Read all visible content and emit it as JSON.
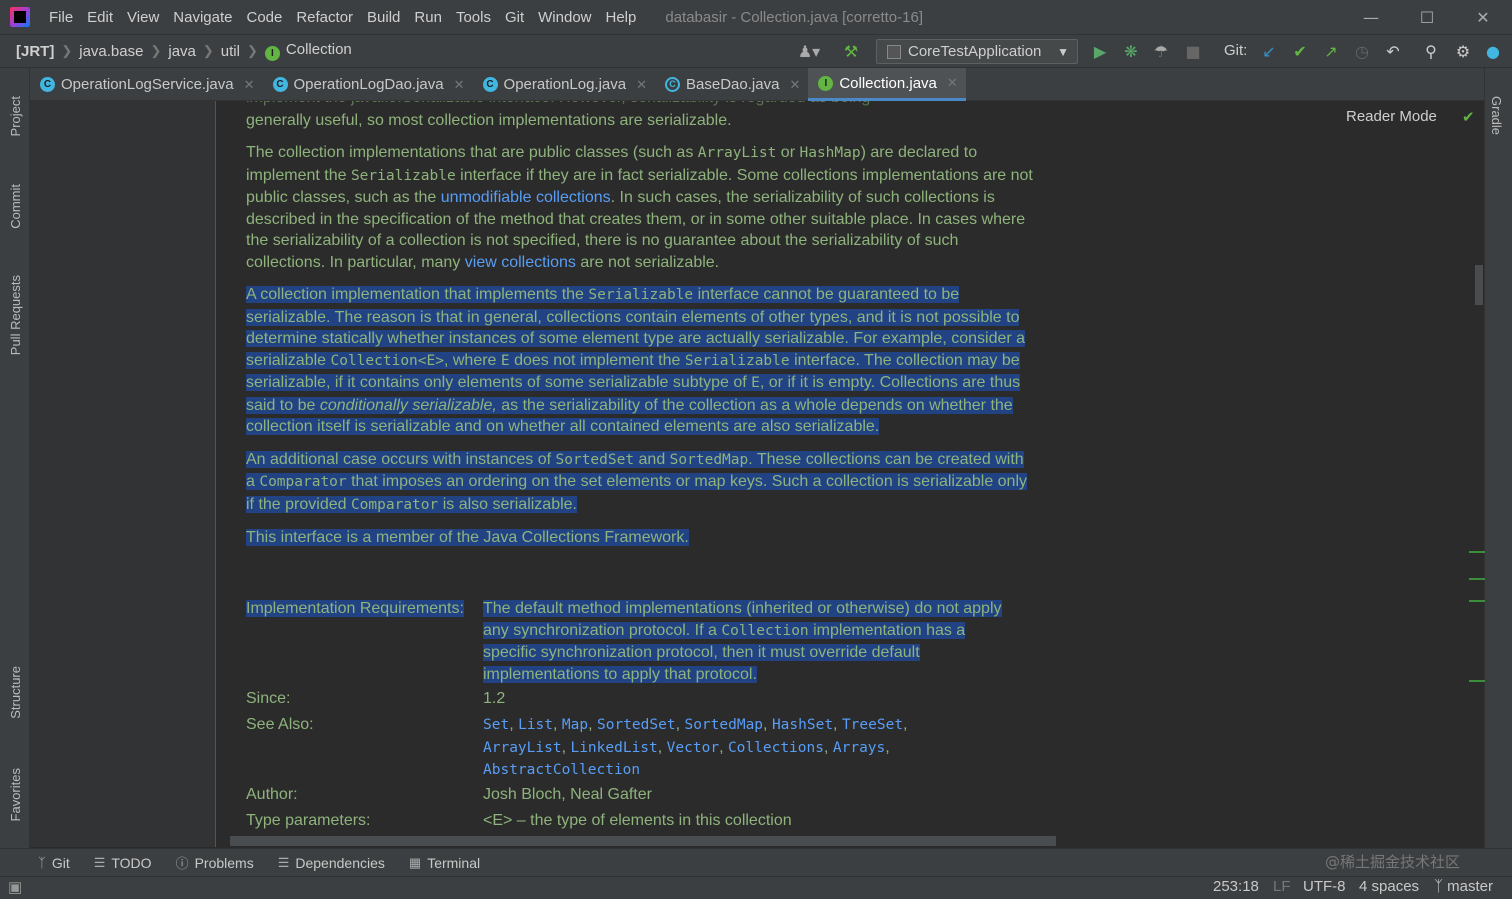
{
  "menubar": {
    "items": [
      "File",
      "Edit",
      "View",
      "Navigate",
      "Code",
      "Refactor",
      "Build",
      "Run",
      "Tools",
      "Git",
      "Window",
      "Help"
    ],
    "window_title": "databasir - Collection.java [corretto-16]"
  },
  "navbar": {
    "breadcrumbs": [
      "[JRT]",
      "java.base",
      "java",
      "util",
      "Collection"
    ],
    "run_config": "CoreTestApplication",
    "git_label": "Git:"
  },
  "tabs": [
    {
      "label": "OperationLogService.java",
      "icon": "class-icon"
    },
    {
      "label": "OperationLogDao.java",
      "icon": "class-icon"
    },
    {
      "label": "OperationLog.java",
      "icon": "class-icon"
    },
    {
      "label": "BaseDao.java",
      "icon": "abstract-class-icon"
    },
    {
      "label": "Collection.java",
      "icon": "interface-icon",
      "active": true
    }
  ],
  "tool_windows": {
    "left": [
      "Project",
      "Commit",
      "Pull Requests",
      "Structure",
      "Favorites"
    ],
    "right": [
      "Gradle"
    ]
  },
  "editor": {
    "reader_mode": "Reader Mode",
    "p0_cut": "implement the java.io.Serializable interface. However, serializability is regarded as being",
    "p0": "generally useful, so most collection implementations are serializable.",
    "p1": {
      "a": "The collection implementations that are public classes (such as ",
      "c1": "ArrayList",
      "b": " or ",
      "c2": "HashMap",
      "c": ") are declared to implement the ",
      "c3": "Serializable",
      "d": " interface if they are in fact serializable. Some collections implementations are not public classes, such as the ",
      "link1": "unmodifiable collections",
      "e": ". In such cases, the serializability of such collections is described in the specification of the method that creates them, or in some other suitable place. In cases where the serializability of a collection is not specified, there is no guarantee about the serializability of such collections. In particular, many ",
      "link2": "view collections",
      "f": " are not serializable."
    },
    "p2": {
      "a": "A collection implementation that implements the ",
      "c1": "Serializable",
      "b": " interface cannot be guaranteed to be serializable. The reason is that in general, collections contain elements of other types, and it is not possible to determine statically whether instances of some element type are actually serializable. For example, consider a serializable ",
      "c2": "Collection<E>",
      "c": ", where ",
      "c3": "E",
      "d": " does not implement the ",
      "c4": "Serializable",
      "e": " interface. The collection may be serializable, if it contains only elements of some serializable subtype of ",
      "c5": "E",
      "f": ", or if it is empty. Collections are thus said to be ",
      "em": "conditionally serializable,",
      "g": " as the serializability of the collection as a whole depends on whether the collection itself is serializable and on whether all contained elements are also serializable."
    },
    "p3": {
      "a": "An additional case occurs with instances of ",
      "c1": "SortedSet",
      "b": " and ",
      "c2": "SortedMap",
      "c": ". These collections can be created with a ",
      "c3": "Comparator",
      "d": " that imposes an ordering on the set elements or map keys. Such a collection is serializable only if the provided ",
      "c4": "Comparator",
      "e": " is also serializable."
    },
    "p4": "This interface is a member of the Java Collections Framework.",
    "impl_req_key": "Implementation Requirements:",
    "impl_req_val": {
      "a": "The default method implementations (inherited or otherwise) do not apply any synchronization protocol. If a ",
      "c1": "Collection",
      "b": " implementation has a specific synchronization protocol, then it must override default implementations to apply that protocol."
    },
    "since_key": "Since:",
    "since_val": "1.2",
    "see_also_key": "See Also:",
    "see_also": [
      "Set",
      "List",
      "Map",
      "SortedSet",
      "SortedMap",
      "HashSet",
      "TreeSet",
      "ArrayList",
      "LinkedList",
      "Vector",
      "Collections",
      "Arrays",
      "AbstractCollection"
    ],
    "author_key": "Author:",
    "author_val": "Josh Bloch, Neal Gafter",
    "type_params_key": "Type parameters:",
    "type_params_val": "<E> – the type of elements in this collection"
  },
  "bottom_tools": [
    {
      "label": "Git",
      "icon": "branch-icon"
    },
    {
      "label": "TODO",
      "icon": "list-icon"
    },
    {
      "label": "Problems",
      "icon": "info-icon"
    },
    {
      "label": "Dependencies",
      "icon": "layers-icon"
    },
    {
      "label": "Terminal",
      "icon": "terminal-icon"
    }
  ],
  "watermark": "@稀土掘金技术社区",
  "status": {
    "position": "253:18",
    "line_sep": "LF",
    "encoding": "UTF-8",
    "indent": "4 spaces",
    "branch": "master"
  },
  "colors": {
    "doc_text": "#8fb37c",
    "link": "#589df6",
    "selection": "#214283",
    "background": "#2b2b2b"
  }
}
